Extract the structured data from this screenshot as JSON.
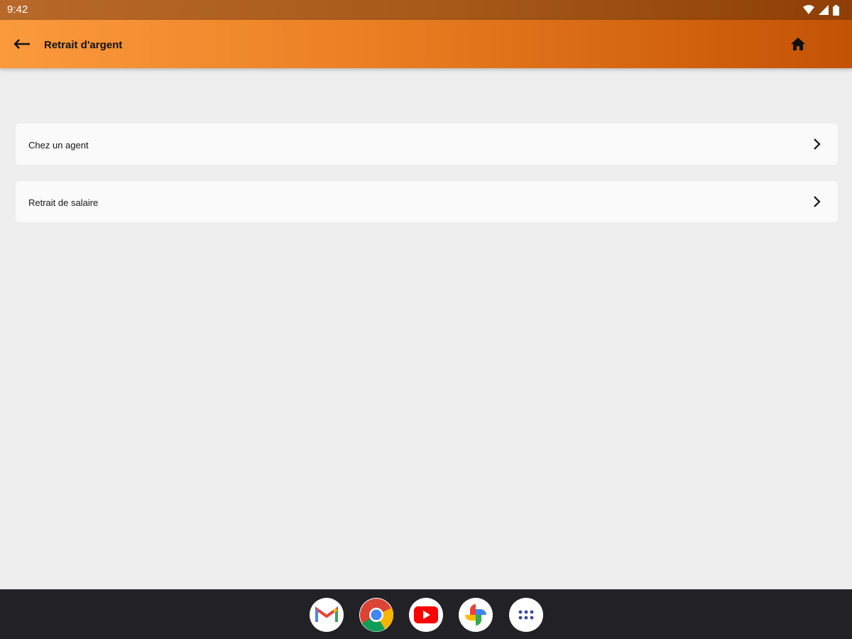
{
  "status_bar": {
    "time": "9:42",
    "icons": [
      "wifi-icon",
      "signal-icon",
      "battery-icon"
    ]
  },
  "app_bar": {
    "title": "Retrait d'argent",
    "back_icon": "arrow-back-icon",
    "home_icon": "home-icon"
  },
  "menu": {
    "items": [
      {
        "label": "Chez un agent",
        "icon": "chevron-right-icon"
      },
      {
        "label": "Retrait de salaire",
        "icon": "chevron-right-icon"
      }
    ]
  },
  "dock": {
    "apps": [
      "gmail-icon",
      "chrome-icon",
      "youtube-icon",
      "photos-icon",
      "app-drawer-icon"
    ]
  },
  "colors": {
    "app_bar_start": "#fb9a3d",
    "app_bar_end": "#c45205",
    "background": "#efeeef",
    "card": "#fafafa",
    "dock": "#222226"
  }
}
